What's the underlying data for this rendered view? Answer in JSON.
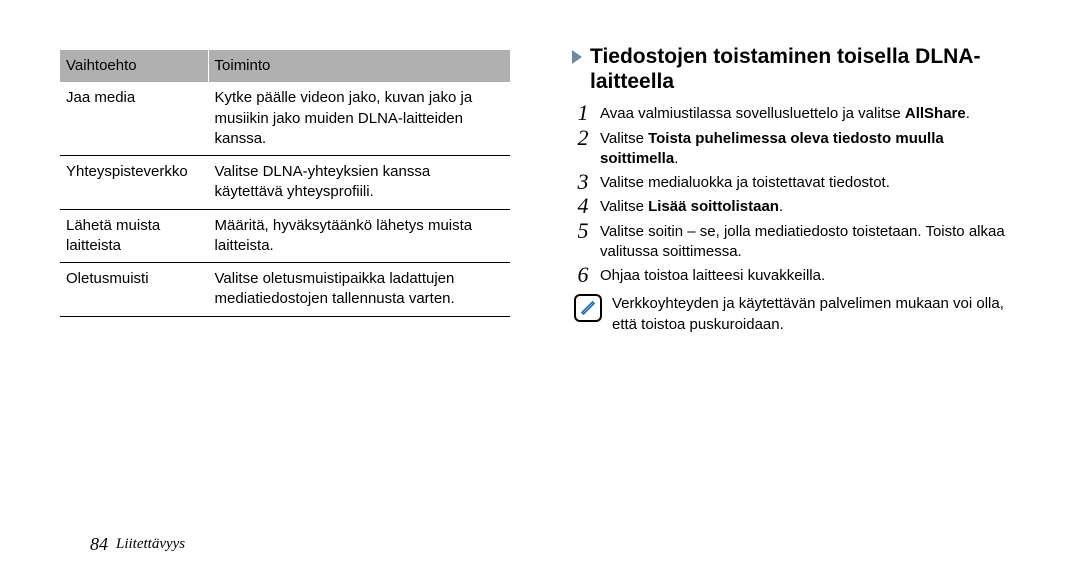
{
  "table": {
    "headers": [
      "Vaihtoehto",
      "Toiminto"
    ],
    "rows": [
      [
        "Jaa media",
        "Kytke päälle videon jako, kuvan jako ja musiikin jako muiden DLNA-laitteiden kanssa."
      ],
      [
        "Yhteyspisteverkko",
        "Valitse DLNA-yhteyksien kanssa käytettävä yhteysprofiili."
      ],
      [
        "Lähetä muista laitteista",
        "Määritä, hyväksytäänkö lähetys muista laitteista."
      ],
      [
        "Oletusmuisti",
        "Valitse oletusmuistipaikka ladattujen mediatiedostojen tallennusta varten."
      ]
    ]
  },
  "heading": "Tiedostojen toistaminen toisella DLNA-laitteella",
  "steps": {
    "s1a": "Avaa valmiustilassa sovellusluettelo ja valitse ",
    "s1b": "AllShare",
    "s1c": ".",
    "s2a": "Valitse ",
    "s2b": "Toista puhelimessa oleva tiedosto muulla soittimella",
    "s2c": ".",
    "s3": "Valitse medialuokka ja toistettavat tiedostot.",
    "s4a": "Valitse ",
    "s4b": "Lisää soittolistaan",
    "s4c": ".",
    "s5": "Valitse soitin – se, jolla mediatiedosto toistetaan. Toisto alkaa valitussa soittimessa.",
    "s6": "Ohjaa toistoa laitteesi kuvakkeilla."
  },
  "note": "Verkkoyhteyden ja käytettävän palvelimen mukaan voi olla, että toistoa puskuroidaan.",
  "footer": {
    "page": "84",
    "section": "Liitettävyys"
  }
}
